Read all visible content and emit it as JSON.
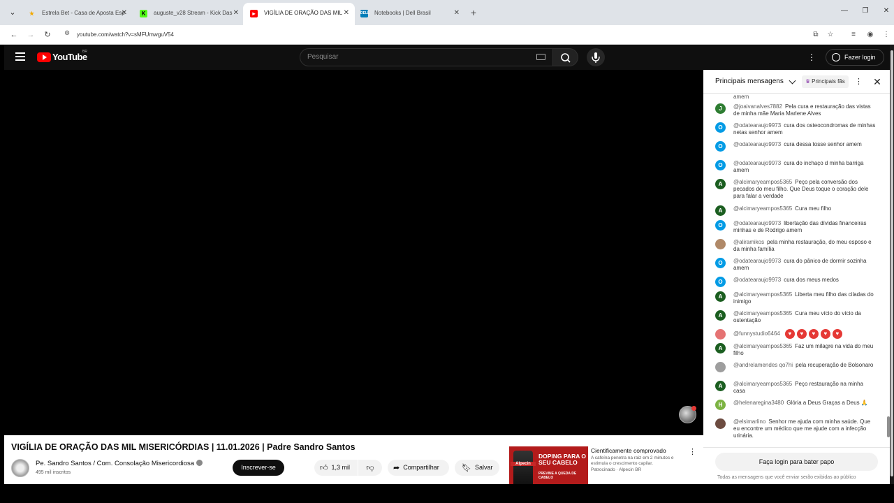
{
  "browser": {
    "tabs": [
      {
        "title": "Estrela Bet - Casa de Aposta Esp",
        "favicon_color": "#f2a900"
      },
      {
        "title": "auguste_v28 Stream - Kick Das",
        "favicon_color": "#53fc18"
      },
      {
        "title": "VIGÍLIA DE ORAÇÃO DAS MIL",
        "favicon_color": "#ff0000"
      },
      {
        "title": "Notebooks | Dell Brasil",
        "favicon_color": "#007db8"
      }
    ],
    "active_tab_index": 2,
    "url": "youtube.com/watch?v=sMFUmwguV54"
  },
  "header": {
    "logo_text": "YouTube",
    "country_code": "BR",
    "search_placeholder": "Pesquisar",
    "login_label": "Fazer login"
  },
  "chat": {
    "title": "Principais mensagens",
    "fans_chip": "Principais fãs",
    "cut_off_text": "amem",
    "messages": [
      {
        "initial": "J",
        "color": "#2e7d32",
        "author": "@joaivanalves7882",
        "text": "Pela cura e restauração das vistas de minha mãe Maria Marlene Alves"
      },
      {
        "initial": "O",
        "color": "#039be5",
        "author": "@odatearaujo9973",
        "text": "cura dos osteocondromas de minhas netas senhor amem"
      },
      {
        "initial": "O",
        "color": "#039be5",
        "author": "@odatearaujo9973",
        "text": "cura dessa tosse senhor amem"
      },
      {
        "initial": "O",
        "color": "#039be5",
        "author": "@odatearaujo9973",
        "text": "cura do inchaço d minha barriga amem"
      },
      {
        "initial": "A",
        "color": "#1b5e20",
        "author": "@alcimaryeampos5365",
        "text": "Peço pela conversão dos pecados do meu filho. Que Deus toque o coração dele para falar a verdade"
      },
      {
        "initial": "A",
        "color": "#1b5e20",
        "author": "@alcimaryeampos5365",
        "text": "Cura meu filho"
      },
      {
        "initial": "O",
        "color": "#039be5",
        "author": "@odatearaujo9973",
        "text": "libertação das dívidas financeiras minhas e de Rodrigo amem"
      },
      {
        "initial": "",
        "color": "#b08968",
        "author": "@aliramikos",
        "text": "pela minha restauração, do meu esposo e da minha família"
      },
      {
        "initial": "O",
        "color": "#039be5",
        "author": "@odatearaujo9973",
        "text": "cura do pânico de dormir sozinha amem"
      },
      {
        "initial": "O",
        "color": "#039be5",
        "author": "@odatearaujo9973",
        "text": "cura dos meus medos"
      },
      {
        "initial": "A",
        "color": "#1b5e20",
        "author": "@alcimaryeampos5365",
        "text": "Liberta meu filho das ciladas do inimigo"
      },
      {
        "initial": "A",
        "color": "#1b5e20",
        "author": "@alcimaryeampos5365",
        "text": "Cura meu vício do vício da ostentação"
      },
      {
        "initial": "",
        "color": "#e57373",
        "author": "@funnystudio6464",
        "text": ""
      },
      {
        "initial": "A",
        "color": "#1b5e20",
        "author": "@alcimaryeampos5365",
        "text": "Faz um milagre na vida do meu filho"
      },
      {
        "initial": "",
        "color": "#9e9e9e",
        "author": "@andrelamendes qo7hi",
        "text": "pela recuperação de Bolsonaro"
      },
      {
        "initial": "A",
        "color": "#1b5e20",
        "author": "@alcimaryeampos5365",
        "text": "Peço restauração na minha casa"
      },
      {
        "initial": "H",
        "color": "#7cb342",
        "author": "@helenaregina3480",
        "text": "Glória a Deus Graças a Deus 🙏"
      },
      {
        "initial": "",
        "color": "#6d4c41",
        "author": "@elsimarlino",
        "text": "Senhor me ajuda com minha saúde. Que eu encontre um médico que me ajude com a infecção urinária."
      }
    ],
    "hearts_count": 5,
    "login_label": "Faça login para bater papo",
    "note": "Todas as mensagens que você enviar serão exibidas ao público"
  },
  "video": {
    "title": "VIGÍLIA DE ORAÇÃO DAS MIL MISERICÓRDIAS | 11.01.2026 | Padre Sandro Santos",
    "channel": "Pe. Sandro Santos / Com. Consolação Misericordiosa",
    "subscribers": "495 mil inscritos",
    "subscribe_label": "Inscrever-se",
    "likes": "1,3 mil",
    "share_label": "Compartilhar",
    "save_label": "Salvar"
  },
  "ad": {
    "headline": "DOPING PARA O SEU CABELO",
    "subline": "PREVINE A QUEDA DE CABELO",
    "brand": "Alpecin",
    "title": "Cientificamente comprovado",
    "description": "A cafeína penetra na raiz em 2 minutos e estimula o crescimento capilar.",
    "sponsor": "Patrocinado · Alpecin BR"
  }
}
